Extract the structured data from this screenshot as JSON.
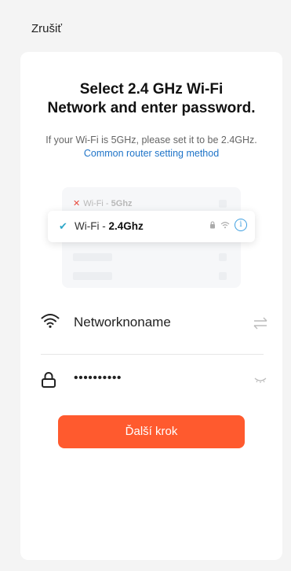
{
  "header": {
    "cancel_label": "Zrušiť"
  },
  "main": {
    "title_line1": "Select 2.4 GHz Wi-Fi",
    "title_line2": "Network and enter password.",
    "subtitle_text": "If your Wi-Fi is 5GHz, please set it to be 2.4GHz.",
    "subtitle_link": "Common router setting method"
  },
  "illustration": {
    "row_5g": {
      "prefix": "Wi-Fi - ",
      "band": "5Ghz",
      "status_icon": "x-icon"
    },
    "row_24g": {
      "prefix": "Wi-Fi - ",
      "band": "2.4Ghz",
      "status_icon": "check-icon"
    }
  },
  "form": {
    "ssid_value": "Networknoname",
    "password_value": "••••••••••",
    "next_label": "Ďalší krok"
  },
  "colors": {
    "accent": "#ff5a2e",
    "link": "#1f74c8",
    "background": "#f4f4f4",
    "check": "#2ea7c8",
    "error": "#e84a3d"
  }
}
